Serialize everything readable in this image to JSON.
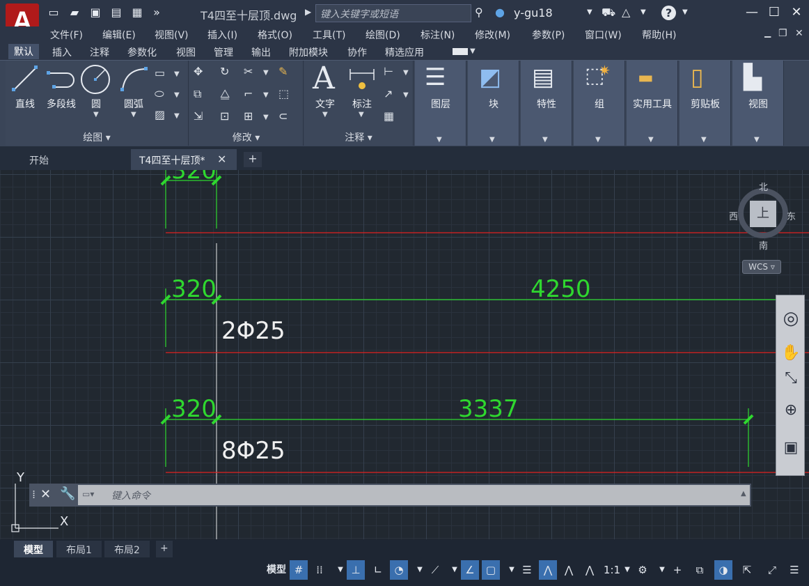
{
  "app": {
    "logo_letter": "A",
    "document_title": "T4四至十层顶.dwg",
    "search_placeholder": "键入关键字或短语",
    "user": "y-gu18"
  },
  "menu": [
    "文件(F)",
    "编辑(E)",
    "视图(V)",
    "插入(I)",
    "格式(O)",
    "工具(T)",
    "绘图(D)",
    "标注(N)",
    "修改(M)",
    "参数(P)",
    "窗口(W)",
    "帮助(H)"
  ],
  "ribbon_tabs": [
    "默认",
    "插入",
    "注释",
    "参数化",
    "视图",
    "管理",
    "输出",
    "附加模块",
    "协作",
    "精选应用"
  ],
  "ribbon_active_tab": "默认",
  "ribbon": {
    "draw_panel": {
      "title": "绘图",
      "tools": [
        "直线",
        "多段线",
        "圆",
        "圆弧"
      ]
    },
    "modify_panel": {
      "title": "修改"
    },
    "annotation_panel": {
      "title": "注释",
      "tools": [
        "文字",
        "标注"
      ]
    },
    "big_tools": [
      "图层",
      "块",
      "特性",
      "组",
      "实用工具",
      "剪贴板",
      "视图"
    ]
  },
  "file_tabs": [
    "开始",
    "T4四至十层顶*"
  ],
  "file_active": "T4四至十层顶*",
  "drawing": {
    "dims": [
      "320",
      "320",
      "4250",
      "320",
      "3337"
    ],
    "rebar_labels": [
      "2Φ25",
      "8Φ25"
    ],
    "colors": {
      "dim": "#2fd82f",
      "red_line": "#e02020",
      "text": "#f0f0f0"
    }
  },
  "viewcube": {
    "north": "北",
    "south": "南",
    "west": "西",
    "east": "东",
    "top": "上",
    "wcs": "WCS"
  },
  "command_line": {
    "placeholder": "键入命令"
  },
  "ucs": {
    "x": "X",
    "y": "Y"
  },
  "layout_tabs": [
    "模型",
    "布局1",
    "布局2"
  ],
  "layout_active": "模型",
  "status": {
    "model_label": "模型",
    "scale": "1:1"
  }
}
